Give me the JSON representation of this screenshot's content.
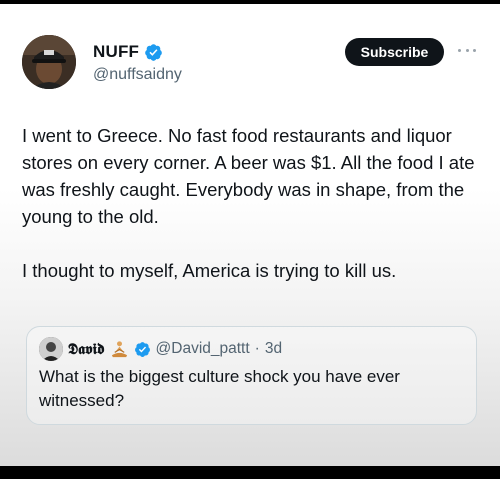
{
  "author": {
    "name": "NUFF",
    "handle": "@nuffsaidny"
  },
  "actions": {
    "subscribe_label": "Subscribe"
  },
  "tweet": {
    "paragraph_1": "I went to Greece. No fast food restaurants and liquor stores on every corner. A beer was $1. All the food I ate was freshly caught. Everybody was in shape, from the young to the old.",
    "paragraph_2": "I thought to myself, America is trying to kill us."
  },
  "quoted_tweet": {
    "name": "𝕯𝖆𝖛𝖎𝖉",
    "handle": "@David_pattt",
    "separator": "·",
    "time": "3d",
    "text": "What is the biggest culture shock you have ever witnessed?"
  },
  "icons": {
    "verified": "verified-badge-icon",
    "more": "more-options-icon",
    "quote_emoji": "meditation-emoji-icon"
  },
  "colors": {
    "verified_blue": "#1d9bf0",
    "subscribe_bg": "#0f1419",
    "text_primary": "#0f1419",
    "text_secondary": "#536471"
  }
}
